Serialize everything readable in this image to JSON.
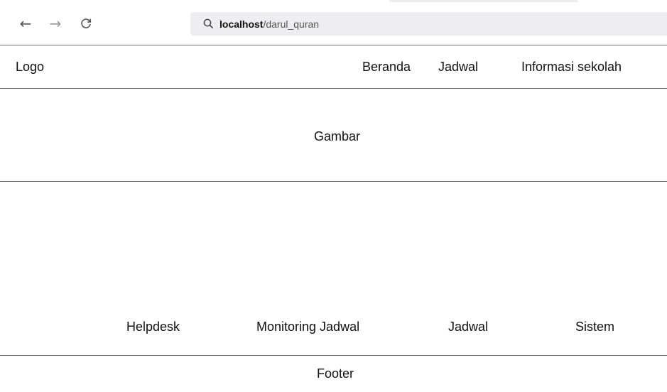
{
  "browser": {
    "url_host": "localhost",
    "url_path": "/darul_quran"
  },
  "icons": {
    "back": "arrow-left-icon",
    "forward": "arrow-right-icon",
    "reload": "reload-icon",
    "search": "search-icon"
  },
  "header": {
    "logo": "Logo",
    "nav": [
      "Beranda",
      "Jadwal",
      "Informasi sekolah"
    ]
  },
  "hero": {
    "label": "Gambar"
  },
  "services": [
    "Helpdesk",
    "Monitoring Jadwal",
    "Jadwal",
    "Sistem"
  ],
  "footer": {
    "label": "Footer"
  }
}
